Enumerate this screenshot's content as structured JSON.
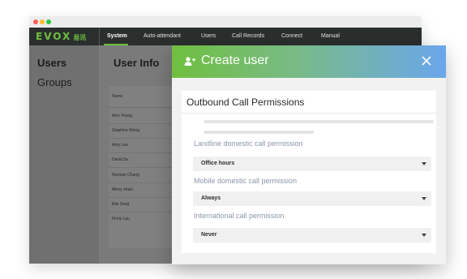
{
  "app": {
    "logo": "EVOX",
    "logo_cn": "易讯",
    "nav": [
      "System",
      "Auto-attendant",
      "Users",
      "Call Records",
      "Connect",
      "Manual"
    ],
    "active_nav": "System"
  },
  "sidebar": {
    "items": [
      {
        "label": "Users",
        "active": true
      },
      {
        "label": "Groups",
        "active": false
      }
    ]
  },
  "main": {
    "title": "User Info",
    "table": {
      "column": "Name",
      "rows": [
        "Alex Yeung",
        "Stephine Wong",
        "Amy Lee",
        "David Su",
        "Norman Chang",
        "Merry shaio",
        "Elle Zong",
        "Finny Lau"
      ]
    }
  },
  "modal": {
    "title": "Create user",
    "close_icon": "close-icon",
    "header_colors": [
      "#6fbf3f",
      "#6aa6ec"
    ],
    "section_title": "Outbound Call Permissions",
    "permissions": [
      {
        "label": "Landline domestic call permission",
        "value": "Office hours"
      },
      {
        "label": "Mobile domestic call permission",
        "value": "Always"
      },
      {
        "label": "International call permission",
        "value": "Never"
      }
    ]
  }
}
